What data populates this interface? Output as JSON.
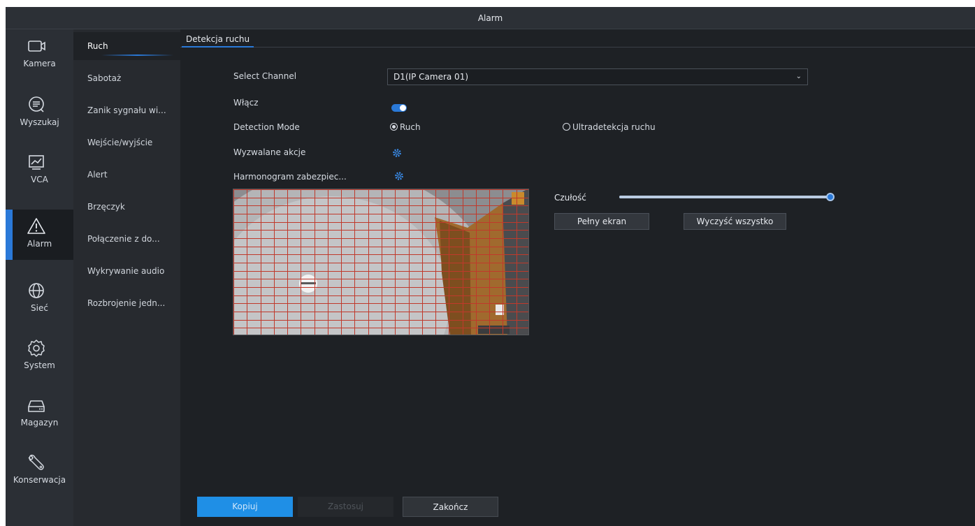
{
  "window": {
    "title": "Alarm"
  },
  "nav": [
    {
      "label": "Kamera",
      "icon": "camera-icon"
    },
    {
      "label": "Wyszukaj",
      "icon": "search-icon"
    },
    {
      "label": "VCA",
      "icon": "chart-icon"
    },
    {
      "label": "Alarm",
      "icon": "alert-triangle-icon",
      "active": true
    },
    {
      "label": "Sieć",
      "icon": "globe-icon"
    },
    {
      "label": "System",
      "icon": "gear-icon"
    },
    {
      "label": "Magazyn",
      "icon": "hdd-icon"
    },
    {
      "label": "Konserwacja",
      "icon": "wrench-icon"
    }
  ],
  "submenu": [
    {
      "label": "Ruch",
      "active": true
    },
    {
      "label": "Sabotaż"
    },
    {
      "label": "Zanik sygnału wi..."
    },
    {
      "label": "Wejście/wyjście"
    },
    {
      "label": "Alert"
    },
    {
      "label": "Brzęczyk"
    },
    {
      "label": "Połączenie z do..."
    },
    {
      "label": "Wykrywanie audio"
    },
    {
      "label": "Rozbrojenie jedn..."
    }
  ],
  "tab": {
    "label": "Detekcja ruchu"
  },
  "form": {
    "channel_label": "Select Channel",
    "channel_value": "D1(IP Camera 01)",
    "enable_label": "Włącz",
    "enable_on": true,
    "mode_label": "Detection Mode",
    "mode_options": [
      "Ruch",
      "Ultradetekcja ruchu"
    ],
    "mode_selected": "Ruch",
    "actions_label": "Wyzwalane akcje",
    "schedule_label": "Harmonogram zabezpiec..."
  },
  "sensitivity": {
    "label": "Czułość",
    "level": 1.0
  },
  "preview_buttons": {
    "fullscreen": "Pełny ekran",
    "clear_all": "Wyczyść wszystko"
  },
  "footer": {
    "copy": "Kopiuj",
    "apply": "Zastosuj",
    "exit": "Zakończ"
  },
  "colors": {
    "accent": "#2a79d8",
    "grid": "#c0392b"
  }
}
